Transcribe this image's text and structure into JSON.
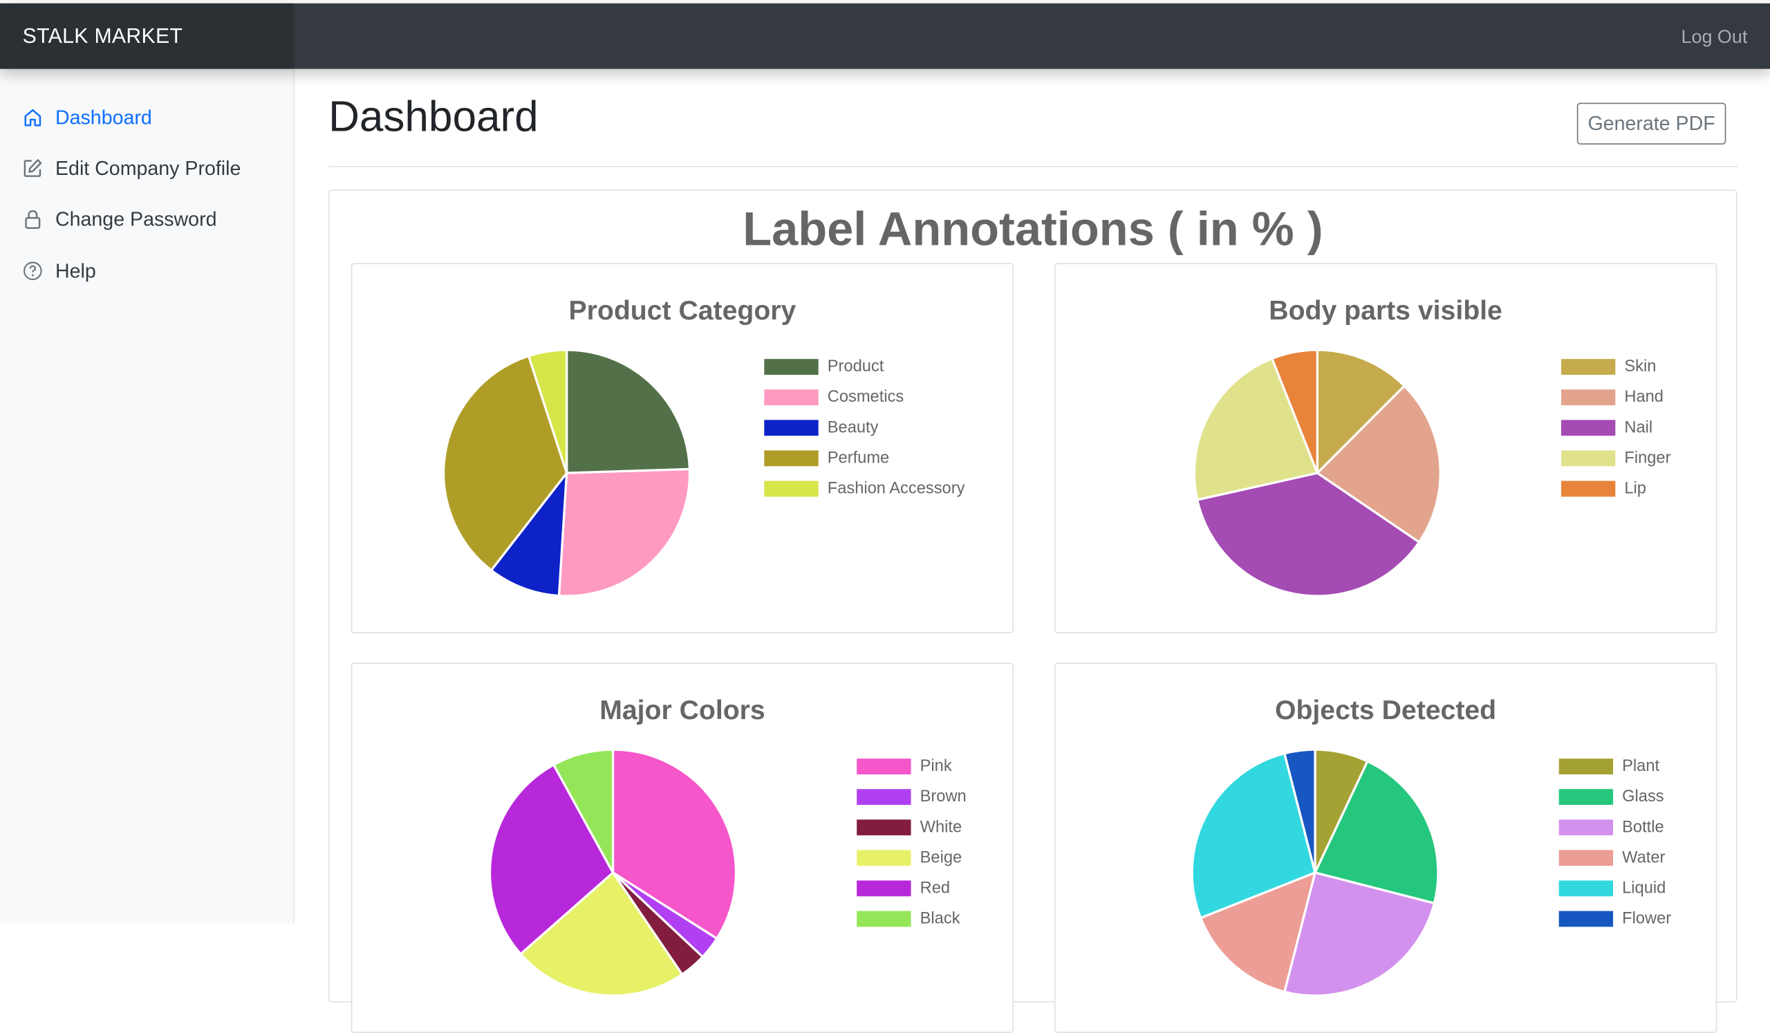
{
  "topbar": {
    "brand": "STALK MARKET",
    "logout": "Log Out"
  },
  "sidebar": {
    "items": [
      {
        "label": "Dashboard",
        "icon": "home-icon",
        "active": true
      },
      {
        "label": "Edit Company Profile",
        "icon": "edit-icon",
        "active": false
      },
      {
        "label": "Change Password",
        "icon": "lock-icon",
        "active": false
      },
      {
        "label": "Help",
        "icon": "help-circle-icon",
        "active": false
      }
    ]
  },
  "main": {
    "title": "Dashboard",
    "generate_pdf": "Generate PDF",
    "section_title": "Label Annotations ( in % )"
  },
  "chart_data": [
    {
      "type": "pie",
      "title": "Product Category",
      "categories": [
        "Product",
        "Cosmetics",
        "Beauty",
        "Perfume",
        "Fashion Accessory"
      ],
      "values": [
        24.5,
        26.5,
        9.5,
        34.5,
        5.0
      ],
      "colors": [
        "#537149",
        "#fe9ac2",
        "#0d22c7",
        "#b09d27",
        "#d6e547"
      ]
    },
    {
      "type": "pie",
      "title": "Body parts visible",
      "categories": [
        "Skin",
        "Hand",
        "Nail",
        "Finger",
        "Lip"
      ],
      "values": [
        12.5,
        22.0,
        37.0,
        22.5,
        6.0
      ],
      "colors": [
        "#c5ab4c",
        "#e3a48d",
        "#a44bb4",
        "#e0e28b",
        "#e8833a"
      ]
    },
    {
      "type": "pie",
      "title": "Major Colors",
      "categories": [
        "Pink",
        "Brown",
        "White",
        "Beige",
        "Red",
        "Black"
      ],
      "values": [
        34.0,
        3.0,
        3.5,
        23.0,
        28.5,
        8.0
      ],
      "colors": [
        "#f556c9",
        "#b140f2",
        "#821d3f",
        "#e7f168",
        "#b828db",
        "#94e658"
      ]
    },
    {
      "type": "pie",
      "title": "Objects Detected",
      "categories": [
        "Plant",
        "Glass",
        "Bottle",
        "Water",
        "Liquid",
        "Flower"
      ],
      "values": [
        7.0,
        22.0,
        25.0,
        15.0,
        27.0,
        4.0
      ],
      "colors": [
        "#a5a235",
        "#25c77e",
        "#d391ee",
        "#ec9d95",
        "#32d8df",
        "#1657c2"
      ]
    }
  ]
}
